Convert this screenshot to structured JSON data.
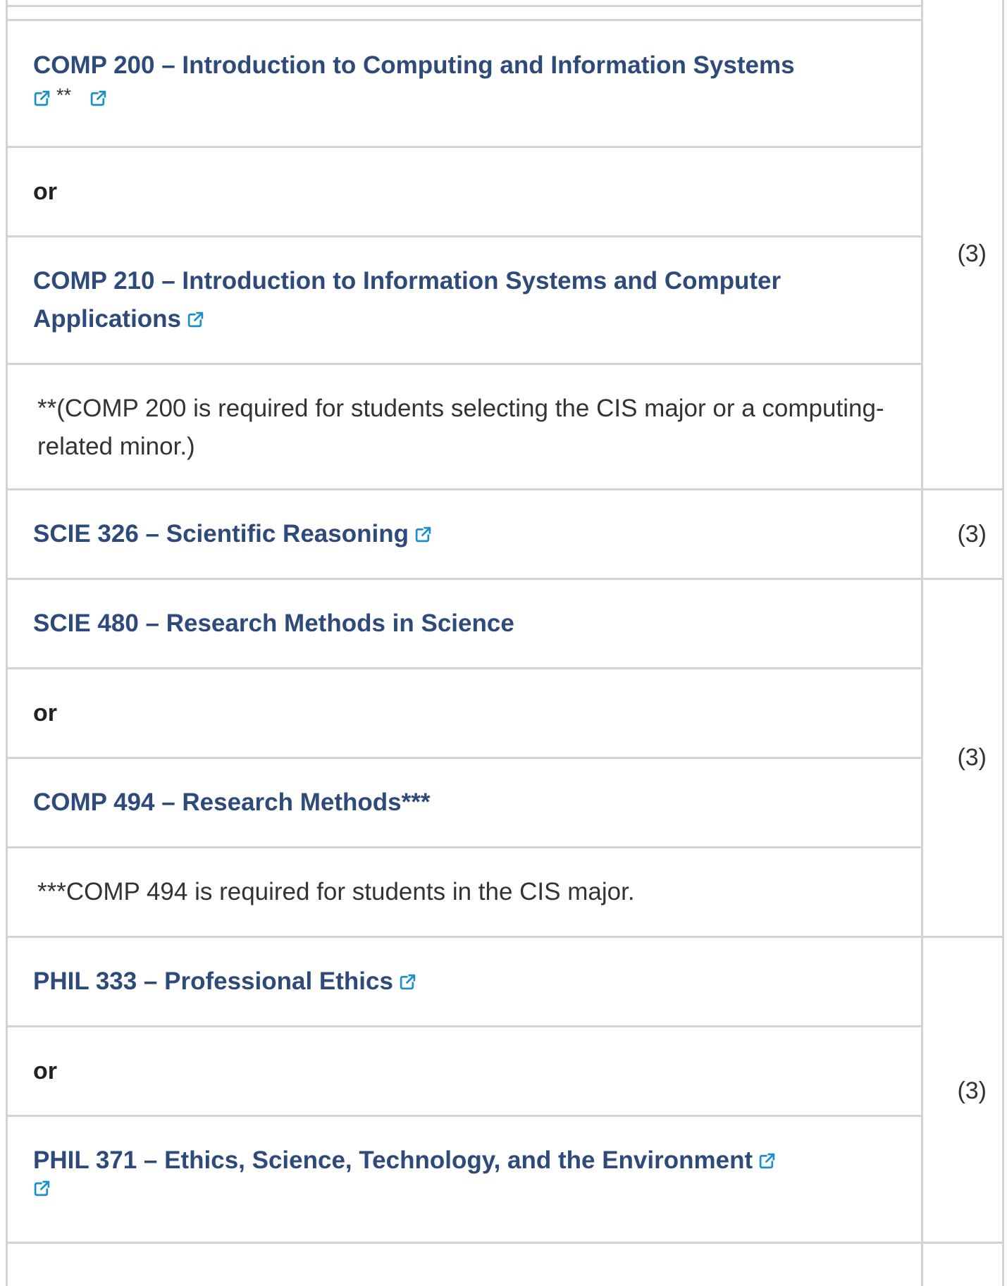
{
  "rows": {
    "comp200": {
      "title": "COMP 200 – Introduction to Computing and Information Systems",
      "mark": "**"
    },
    "or1": "or",
    "comp210": {
      "title": "COMP 210 – Introduction to Information Systems and Computer Applications"
    },
    "note1": "**(COMP 200 is required for students selecting the CIS major or a computing-related minor.)",
    "credits1": "(3)",
    "scie326": {
      "title": "SCIE 326 – Scientific Reasoning"
    },
    "credits2": "(3)",
    "scie480": {
      "title": "SCIE 480 – Research Methods in Science"
    },
    "or2": "or",
    "comp494": {
      "title": "COMP 494 – Research Methods***"
    },
    "note2": "***COMP 494 is required for students in the CIS major.",
    "credits3": "(3)",
    "phil333": {
      "title": "PHIL 333 – Professional Ethics"
    },
    "or3": "or",
    "phil371": {
      "title": "PHIL 371 – Ethics, Science, Technology, and the Environment"
    },
    "credits4": "(3)"
  },
  "icons": {
    "external_link": "external-link-icon"
  },
  "colors": {
    "link": "#2e4a7b",
    "icon": "#1a8fc9",
    "border": "#d3d3d3",
    "text": "#333333"
  }
}
